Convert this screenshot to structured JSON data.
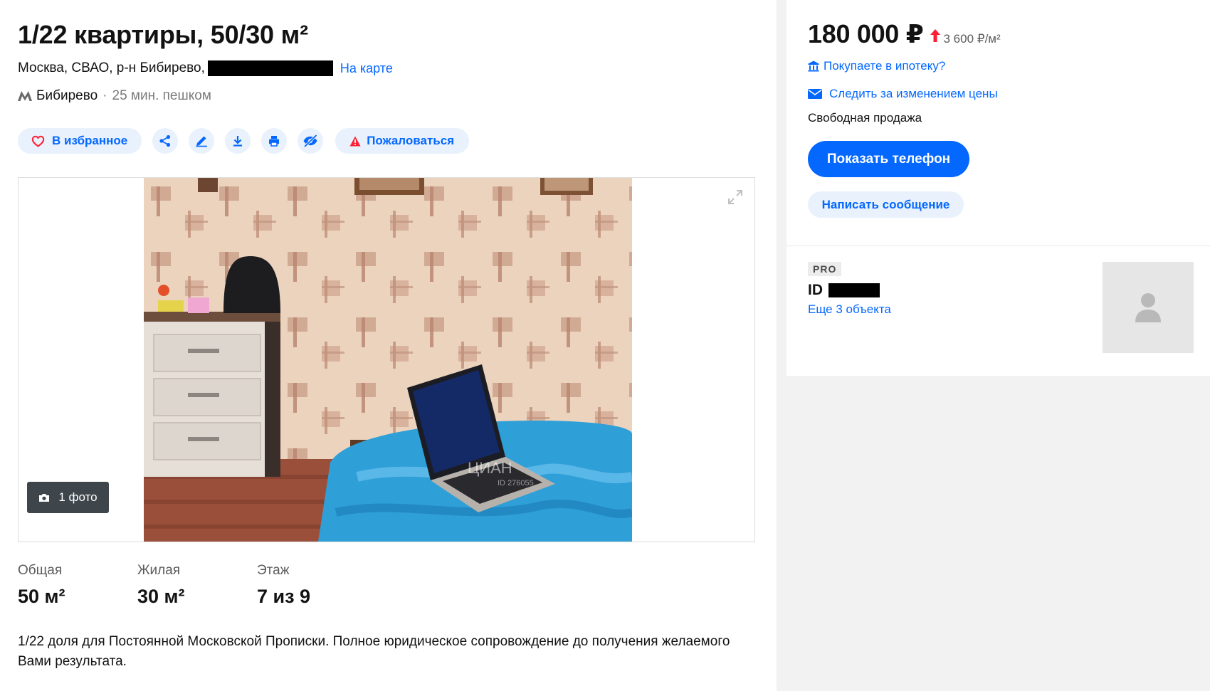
{
  "listing": {
    "title": "1/22 квартиры, 50/30 м²",
    "address": "Москва, СВАО, р-н Бибирево,",
    "map_link": "На карте",
    "metro_station": "Бибирево",
    "metro_separator": "·",
    "metro_walk": "25 мин. пешком"
  },
  "actions": {
    "favorite_label": "В избранное",
    "share_icon": "share-icon",
    "edit_icon": "pencil-icon",
    "download_icon": "download-icon",
    "print_icon": "printer-icon",
    "hide_icon": "eye-off-icon",
    "complain_label": "Пожаловаться"
  },
  "gallery": {
    "photo_count": "1 фото",
    "watermark_brand": "ЦИАН",
    "watermark_id": "ID 276055"
  },
  "facts": [
    {
      "label": "Общая",
      "value": "50 м²"
    },
    {
      "label": "Жилая",
      "value": "30 м²"
    },
    {
      "label": "Этаж",
      "value": "7 из 9"
    }
  ],
  "description": "1/22 доля для Постоянной Московской Прописки. Полное юридическое сопровождение до получения желаемого Вами результата.",
  "sidebar": {
    "price": "180 000 ₽",
    "price_per_sqm": "3 600 ₽/м²",
    "mortgage_link": "Покупаете в ипотеку?",
    "watch_price_link": "Следить за изменением цены",
    "sale_type": "Свободная продажа",
    "show_phone_button": "Показать телефон",
    "write_message_button": "Написать сообщение"
  },
  "agent": {
    "badge": "PRO",
    "id_label": "ID",
    "more_objects": "Еще 3 объекта"
  },
  "colors": {
    "accent": "#0468ff",
    "accent_light": "#e9f1fc",
    "price_up": "#ff1f34",
    "favorite_heart": "#ff1f34",
    "warning": "#ff1f34"
  }
}
